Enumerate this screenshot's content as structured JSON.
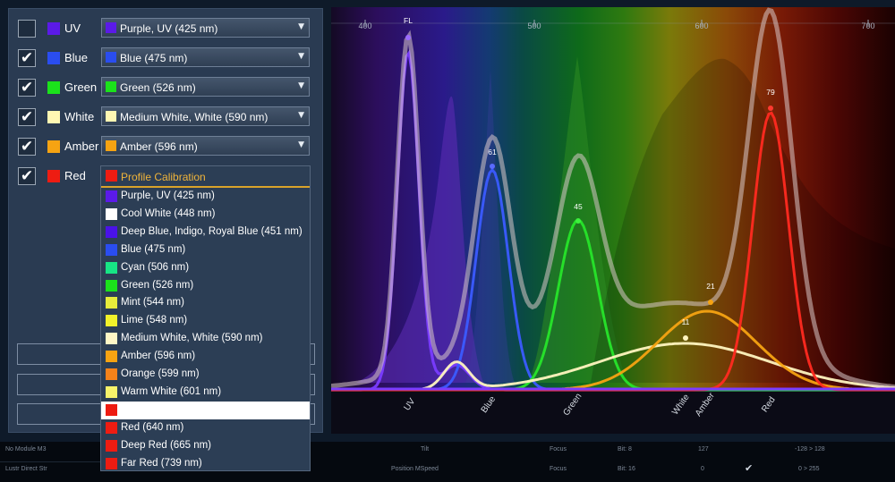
{
  "channels": [
    {
      "label": "UV",
      "checked": false,
      "color": "#5b1ae8",
      "selection": "Purple, UV (425 nm)"
    },
    {
      "label": "Blue",
      "checked": true,
      "color": "#2a4df0",
      "selection": "Blue (475 nm)"
    },
    {
      "label": "Green",
      "checked": true,
      "color": "#1be21b",
      "selection": "Green (526 nm)"
    },
    {
      "label": "White",
      "checked": true,
      "color": "#fff7b3",
      "selection": "Medium White, White (590 nm)"
    },
    {
      "label": "Amber",
      "checked": true,
      "color": "#f6a312",
      "selection": "Amber (596 nm)"
    },
    {
      "label": "Red",
      "checked": true,
      "color": "#ee1c12",
      "selection": "Profile Calibration"
    }
  ],
  "check_mark": "✔",
  "dropdown_arrow": "▼",
  "dropdown": {
    "header": {
      "label": "Profile Calibration",
      "color": "#ee1c12"
    },
    "options": [
      {
        "label": "Purple, UV (425 nm)",
        "color": "#5b1ae8"
      },
      {
        "label": "Cool White (448 nm)",
        "color": "#ffffff"
      },
      {
        "label": "Deep Blue, Indigo, Royal Blue (451 nm)",
        "color": "#4a12e8"
      },
      {
        "label": "Blue (475 nm)",
        "color": "#2a4df0"
      },
      {
        "label": "Cyan (506 nm)",
        "color": "#17e585"
      },
      {
        "label": "Green (526 nm)",
        "color": "#1be21b"
      },
      {
        "label": "Mint (544 nm)",
        "color": "#e7ec3b"
      },
      {
        "label": "Lime (548 nm)",
        "color": "#f2f22a"
      },
      {
        "label": "Medium White, White (590 nm)",
        "color": "#fff7c6"
      },
      {
        "label": "Amber (596 nm)",
        "color": "#f6a312"
      },
      {
        "label": "Orange (599 nm)",
        "color": "#f5821a"
      },
      {
        "label": "Warm White (601 nm)",
        "color": "#f8f36a"
      },
      {
        "label": "",
        "color": "#ee1c12",
        "highlighted": true
      },
      {
        "label": "Red (640 nm)",
        "color": "#ee1c12"
      },
      {
        "label": "Deep Red (665 nm)",
        "color": "#ee1c12"
      },
      {
        "label": "Far Red (739 nm)",
        "color": "#ee1c12"
      }
    ]
  },
  "spectrum": {
    "axis_ticks": [
      "400",
      "500",
      "600",
      "700"
    ],
    "peak_labels": [
      "FL",
      "61",
      "45",
      "79",
      "21",
      "11"
    ],
    "channel_labels": [
      "UV",
      "Blue",
      "Green",
      "White",
      "Amber",
      "Red"
    ]
  },
  "bottom_bar": [
    "No Module M3",
    "Lustr Direct Str",
    "Tilt",
    "Position MSpeed",
    "Focus",
    "Focus",
    "Bit: 8",
    "Bit: 16",
    "127",
    "0",
    "-128 > 128",
    "0 > 255"
  ]
}
